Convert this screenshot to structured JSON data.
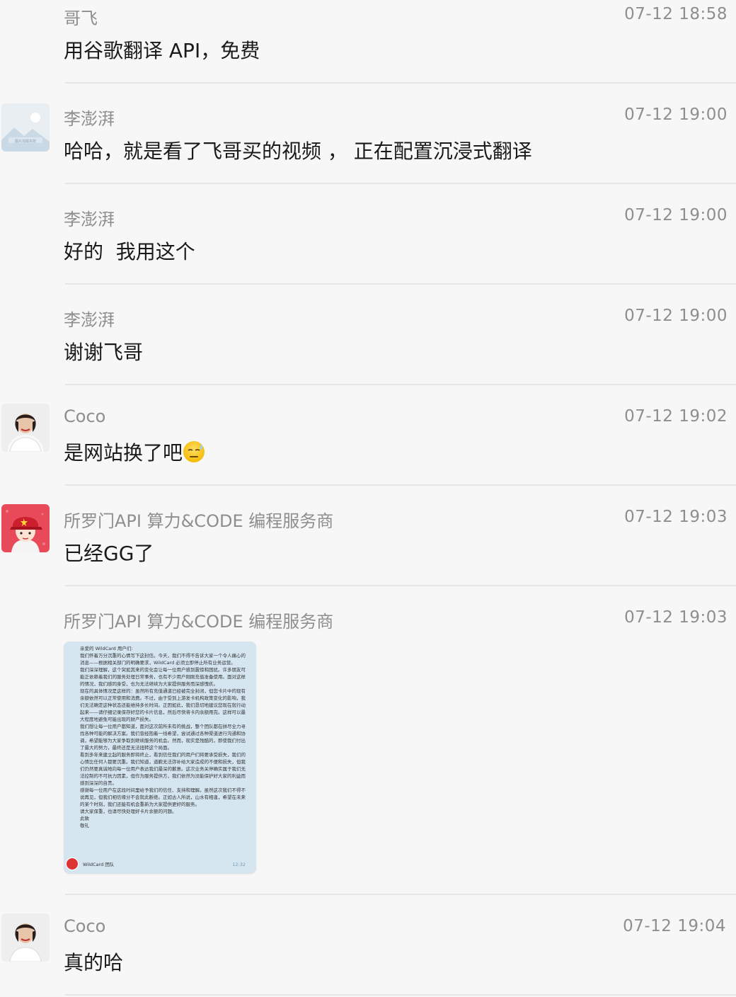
{
  "messages": [
    {
      "sender": "哥飞",
      "time": "07-12 18:58",
      "text": "用谷歌翻译 API，免费",
      "avatar": "none"
    },
    {
      "sender": "李澎湃",
      "time": "07-12 19:00",
      "text": "哈哈，就是看了飞哥买的视频 ， 正在配置沉浸式翻译",
      "avatar": "landscape-placeholder"
    },
    {
      "sender": "李澎湃",
      "time": "07-12 19:00",
      "text": "好的  我用这个",
      "avatar": "none"
    },
    {
      "sender": "李澎湃",
      "time": "07-12 19:00",
      "text": "谢谢飞哥",
      "avatar": "none"
    },
    {
      "sender": "Coco",
      "time": "07-12 19:02",
      "text": "是网站换了吧",
      "emoji": "sweat-smile-icon",
      "avatar": "person-photo"
    },
    {
      "sender": "所罗门API 算力&CODE 编程服务商",
      "time": "07-12 19:03",
      "text": "已经GG了",
      "avatar": "cartoon-red-cap"
    },
    {
      "sender": "所罗门API 算力&CODE 编程服务商",
      "time": "07-12 19:03",
      "image": {
        "title": "亲爱的 WildCard 用户们:",
        "body": "我们怀着万分沉重的心情写下这封信。今天，我们不得不告诉大家一个令人痛心的消息——根据相关部门的明确要求，WildCard 必须立即停止所有业务运营。\n我们深深理解，这个突如其来的变化会让每一位用户感到震惊和困扰。许多朋友可能正依赖着我们的服务处理日常事务，也有不少用户刚刚充值准备使用。面对这样的情况，我们感同身受，也为无法继续为大家提供服务而深感愧疚。\n现在的具体情况是这样的：虽然所有充值通道已经被完全封闭，但您卡片中的现有余额依然可以正常使用和消费。不过，由于受到上游发卡机构政策变化的影响，我们无法确定这种状态还能维持多长时间。正因如此，我们恳切地建议您现在就行动起来——请仔细记录保存好您的卡片信息，然后尽快将卡内余额用完。这样可以最大程度地避免可能出现的财产损失。\n我们想让每一位用户都知道，面对这次前所未有的挑战，整个团队都在拼尽全力寻找各种可能的解决方案。我们曾经抱着一线希望，尝试通过各种渠道进行沟通和协调，希望能够为大家争取到继续服务的机会。然而，现实是残酷的，即使我们付出了最大的努力，最终还是无法扭转这个局面。\n看到多年来建立起的服务即将终止，看到信任我们的用户们将要承受损失，我们的心情比任何人都要沉重。我们知道，道歉无法弥补给大家造成的不便和损失，但我们仍然要真诚地向每一位用户表达我们最深的歉意。这次业务关停确实属于我们无法控制的不可抗力因素，但作为服务提供方，我们依然为没能保护好大家的利益而感到深深的自责。\n感谢每一位用户在这段时间里给予我们的信任、支持和理解。虽然这次我们不得不说再见，但我们相信缘分不会就此断绝。正如古人所说，山水有相逢，希望在未来的某个时刻，我们还能有机会重新为大家提供更好的服务。\n请大家保重，也请尽快处理好卡片余额的问题。\n此致\n敬礼",
        "signature": "WildCard 团队",
        "stamp_time": "12:32"
      },
      "avatar": "none"
    },
    {
      "sender": "Coco",
      "time": "07-12 19:04",
      "text": "真的哈",
      "avatar": "person-photo"
    }
  ]
}
